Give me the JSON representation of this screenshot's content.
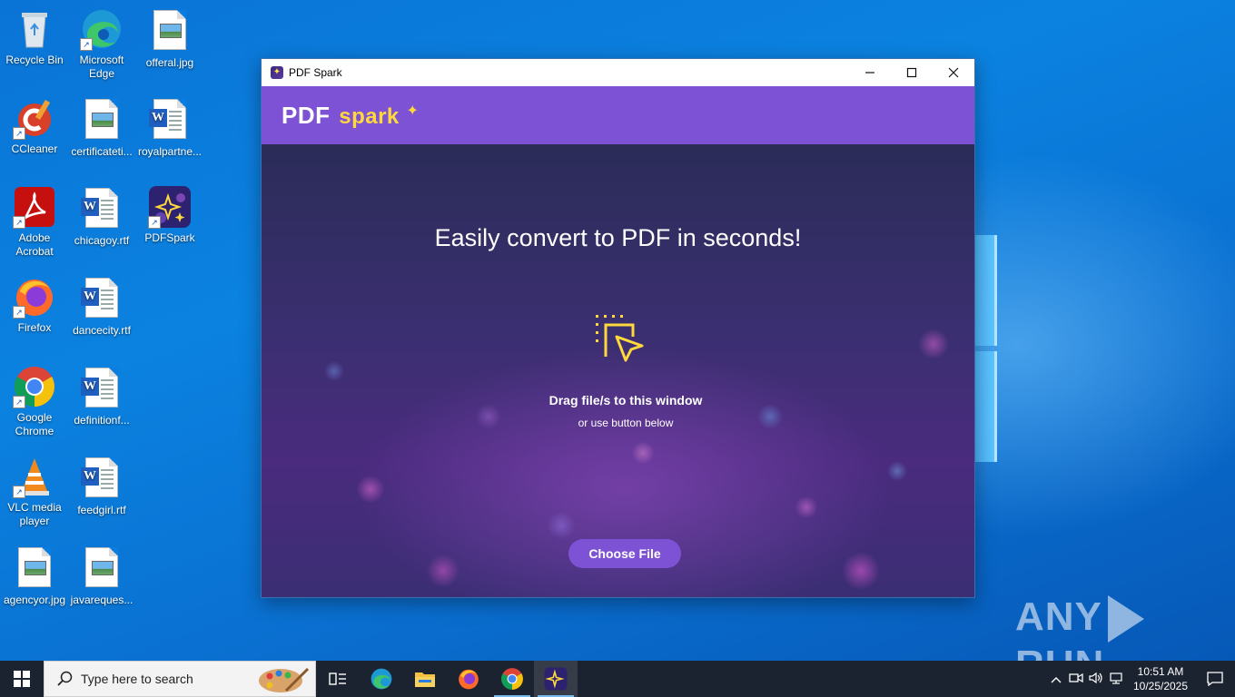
{
  "desktop": {
    "icons": [
      {
        "label": "Recycle Bin",
        "icon": "recycle-bin-icon"
      },
      {
        "label": "Microsoft Edge",
        "icon": "edge-icon"
      },
      {
        "label": "offeral.jpg",
        "icon": "image-file-icon"
      },
      {
        "label": "CCleaner",
        "icon": "ccleaner-icon"
      },
      {
        "label": "certificateti...",
        "icon": "image-file-icon"
      },
      {
        "label": "royalpartne...",
        "icon": "word-doc-icon"
      },
      {
        "label": "Adobe Acrobat",
        "icon": "acrobat-icon"
      },
      {
        "label": "chicagoy.rtf",
        "icon": "word-doc-icon"
      },
      {
        "label": "PDFSpark",
        "icon": "pdfspark-icon"
      },
      {
        "label": "Firefox",
        "icon": "firefox-icon"
      },
      {
        "label": "dancecity.rtf",
        "icon": "word-doc-icon"
      },
      {
        "label": "Google Chrome",
        "icon": "chrome-icon"
      },
      {
        "label": "definitionf...",
        "icon": "word-doc-icon"
      },
      {
        "label": "VLC media player",
        "icon": "vlc-icon"
      },
      {
        "label": "feedgirl.rtf",
        "icon": "word-doc-icon"
      },
      {
        "label": "agencyor.jpg",
        "icon": "image-file-icon"
      },
      {
        "label": "javareques...",
        "icon": "image-file-icon"
      }
    ]
  },
  "window": {
    "title": "PDF Spark",
    "logo_main": "PDF",
    "logo_accent": "spark",
    "headline": "Easily convert to PDF in seconds!",
    "drag_text": "Drag file/s to this window",
    "or_text": "or use button below",
    "choose_button": "Choose File",
    "controls": {
      "minimize": "minimize-icon",
      "maximize": "maximize-icon",
      "close": "close-icon"
    }
  },
  "watermark": {
    "left": "ANY",
    "right": "RUN"
  },
  "taskbar": {
    "search_placeholder": "Type here to search",
    "apps": [
      "task-view-icon",
      "edge-icon",
      "file-explorer-icon",
      "firefox-icon",
      "chrome-icon",
      "pdfspark-icon"
    ],
    "clock_time": "10:51 AM",
    "clock_date": "10/25/2025"
  },
  "colors": {
    "accent": "#7e52d4",
    "logo_yellow": "#ffd93b",
    "taskbar": "#1b2330"
  }
}
